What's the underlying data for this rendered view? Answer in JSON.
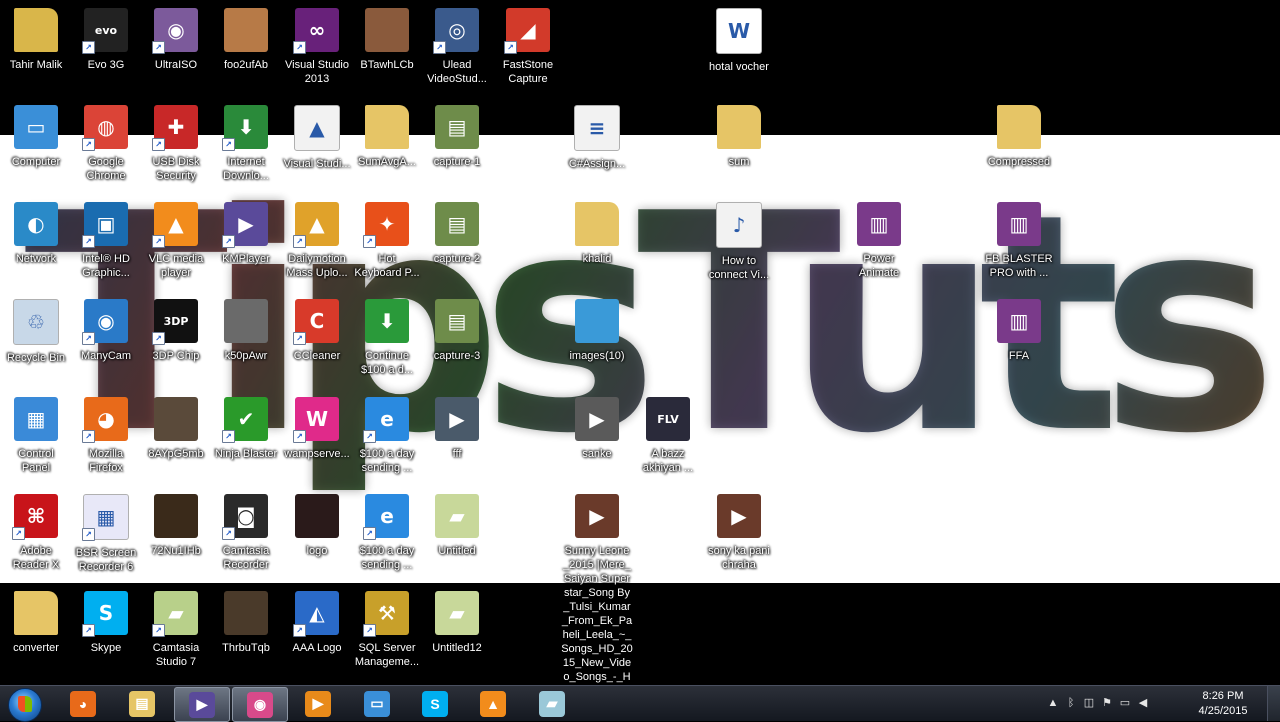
{
  "desktop": {
    "icons": [
      {
        "label": "Tahir Malik",
        "icon": "user-folder-icon",
        "color": "#d9b64a",
        "glyph": "",
        "shortcut": false
      },
      {
        "label": "Evo 3G",
        "icon": "evo-icon",
        "color": "#222222",
        "glyph": "evo",
        "shortcut": true
      },
      {
        "label": "UltraISO",
        "icon": "disc-icon",
        "color": "#7c5a9b",
        "glyph": "◉",
        "shortcut": true
      },
      {
        "label": "foo2ufAb",
        "icon": "photo-icon",
        "color": "#b77a47",
        "glyph": "",
        "shortcut": false
      },
      {
        "label": "Visual Studio\n2013",
        "icon": "visual-studio-icon",
        "color": "#68217a",
        "glyph": "∞",
        "shortcut": true
      },
      {
        "label": "BTawhLCb",
        "icon": "photo-icon",
        "color": "#8a5a3c",
        "glyph": "",
        "shortcut": false
      },
      {
        "label": "Ulead\nVideoStud...",
        "icon": "video-studio-icon",
        "color": "#3a5a8c",
        "glyph": "◎",
        "shortcut": true
      },
      {
        "label": "FastStone\nCapture",
        "icon": "faststone-icon",
        "color": "#d23a2a",
        "glyph": "◢",
        "shortcut": true
      },
      {
        "label": "hotal vocher",
        "icon": "word-document-icon",
        "color": "#ffffff",
        "glyph": "W",
        "shortcut": false
      },
      {
        "label": "Computer",
        "icon": "computer-icon",
        "color": "#3a8fd8",
        "glyph": "▭",
        "shortcut": false
      },
      {
        "label": "Google\nChrome",
        "icon": "chrome-icon",
        "color": "#db4437",
        "glyph": "◍",
        "shortcut": true
      },
      {
        "label": "USB Disk\nSecurity",
        "icon": "shield-icon",
        "color": "#c82828",
        "glyph": "✚",
        "shortcut": true
      },
      {
        "label": "Internet\nDownlo...",
        "icon": "download-manager-icon",
        "color": "#2a8a3a",
        "glyph": "⬇",
        "shortcut": true
      },
      {
        "label": "Visual Studi...",
        "icon": "vlc-file-icon",
        "color": "#f2f2f2",
        "glyph": "▲",
        "shortcut": false
      },
      {
        "label": "SumAvgA...",
        "icon": "folder-icon",
        "color": "#e6c566",
        "glyph": "",
        "shortcut": false
      },
      {
        "label": "capture-1",
        "icon": "video-file-icon",
        "color": "#6e8c4a",
        "glyph": "▤",
        "shortcut": false
      },
      {
        "label": "C#Assign...",
        "icon": "text-file-icon",
        "color": "#f2f2f2",
        "glyph": "≡",
        "shortcut": false
      },
      {
        "label": "sum",
        "icon": "folder-icon",
        "color": "#e6c566",
        "glyph": "",
        "shortcut": false
      },
      {
        "label": "Compressed",
        "icon": "folder-icon",
        "color": "#e6c566",
        "glyph": "",
        "shortcut": false
      },
      {
        "label": "Network",
        "icon": "network-icon",
        "color": "#2a8ac8",
        "glyph": "◐",
        "shortcut": false
      },
      {
        "label": "Intel® HD\nGraphic...",
        "icon": "intel-icon",
        "color": "#1a6cb0",
        "glyph": "▣",
        "shortcut": true
      },
      {
        "label": "VLC media\nplayer",
        "icon": "vlc-icon",
        "color": "#f28c1c",
        "glyph": "▲",
        "shortcut": true
      },
      {
        "label": "KMPlayer",
        "icon": "kmplayer-icon",
        "color": "#5a4a9a",
        "glyph": "▶",
        "shortcut": true
      },
      {
        "label": "Dailymotion\nMass Uplo...",
        "icon": "rocket-icon",
        "color": "#e0a22a",
        "glyph": "▲",
        "shortcut": true
      },
      {
        "label": "Hot\nKeyboard P...",
        "icon": "hot-keyboard-icon",
        "color": "#e8501a",
        "glyph": "✦",
        "shortcut": true
      },
      {
        "label": "capture-2",
        "icon": "video-file-icon",
        "color": "#6e8c4a",
        "glyph": "▤",
        "shortcut": false
      },
      {
        "label": "khalid",
        "icon": "folder-icon",
        "color": "#e6c566",
        "glyph": "",
        "shortcut": false
      },
      {
        "label": "How to\nconnect Vi...",
        "icon": "audio-file-icon",
        "color": "#f2f2f2",
        "glyph": "♪",
        "shortcut": false
      },
      {
        "label": "Power\nAnimate",
        "icon": "winrar-icon",
        "color": "#7a3a8a",
        "glyph": "▥",
        "shortcut": false
      },
      {
        "label": "FB BLASTER\nPRO with ...",
        "icon": "winrar-icon",
        "color": "#7a3a8a",
        "glyph": "▥",
        "shortcut": false
      },
      {
        "label": "Recycle Bin",
        "icon": "recycle-bin-icon",
        "color": "#c8d8e8",
        "glyph": "♲",
        "shortcut": false
      },
      {
        "label": "ManyCam",
        "icon": "manycam-icon",
        "color": "#2a7ac8",
        "glyph": "◉",
        "shortcut": true
      },
      {
        "label": "3DP Chip",
        "icon": "3dp-chip-icon",
        "color": "#111111",
        "glyph": "3DP",
        "shortcut": true
      },
      {
        "label": "k50pAwr",
        "icon": "photo-icon",
        "color": "#6a6a6a",
        "glyph": "",
        "shortcut": false
      },
      {
        "label": "CCleaner",
        "icon": "ccleaner-icon",
        "color": "#d83a2a",
        "glyph": "C",
        "shortcut": true
      },
      {
        "label": "Continue\n$100 a d...",
        "icon": "setup-icon",
        "color": "#2a9a3a",
        "glyph": "⬇",
        "shortcut": false
      },
      {
        "label": "capture-3",
        "icon": "video-file-icon",
        "color": "#6e8c4a",
        "glyph": "▤",
        "shortcut": false
      },
      {
        "label": "images(10)",
        "icon": "image-file-icon",
        "color": "#3a9ad8",
        "glyph": "",
        "shortcut": false
      },
      {
        "label": "FFA",
        "icon": "winrar-icon",
        "color": "#7a3a8a",
        "glyph": "▥",
        "shortcut": false
      },
      {
        "label": "Control\nPanel",
        "icon": "control-panel-icon",
        "color": "#3a8ad8",
        "glyph": "▦",
        "shortcut": false
      },
      {
        "label": "Mozilla\nFirefox",
        "icon": "firefox-icon",
        "color": "#e86a1a",
        "glyph": "◕",
        "shortcut": true
      },
      {
        "label": "8AYpG5mb",
        "icon": "photo-icon",
        "color": "#5a4a3a",
        "glyph": "",
        "shortcut": false
      },
      {
        "label": "Ninja Blaster",
        "icon": "checkmark-icon",
        "color": "#2a9a2a",
        "glyph": "✔",
        "shortcut": true
      },
      {
        "label": "wampserve...",
        "icon": "wampserver-icon",
        "color": "#e02a8a",
        "glyph": "W",
        "shortcut": true
      },
      {
        "label": "$100 a day\nsending ...",
        "icon": "internet-explorer-icon",
        "color": "#2a8ae0",
        "glyph": "e",
        "shortcut": true
      },
      {
        "label": "fff",
        "icon": "video-file-icon",
        "color": "#4a5a6a",
        "glyph": "▶",
        "shortcut": false
      },
      {
        "label": "sanke",
        "icon": "video-file-icon",
        "color": "#5a5a5a",
        "glyph": "▶",
        "shortcut": false
      },
      {
        "label": "A bazz\nakhiyan ...",
        "icon": "flv-file-icon",
        "color": "#2a2a3a",
        "glyph": "FLV",
        "shortcut": false
      },
      {
        "label": "Adobe\nReader X",
        "icon": "adobe-reader-icon",
        "color": "#c8141a",
        "glyph": "⌘",
        "shortcut": true
      },
      {
        "label": "BSR Screen\nRecorder 6",
        "icon": "bsr-recorder-icon",
        "color": "#e8e8f8",
        "glyph": "▦",
        "shortcut": true
      },
      {
        "label": "72Nu1IHb",
        "icon": "photo-icon",
        "color": "#3a2a1a",
        "glyph": "",
        "shortcut": false
      },
      {
        "label": "Camtasia\nRecorder",
        "icon": "camtasia-recorder-icon",
        "color": "#2a2a2a",
        "glyph": "◙",
        "shortcut": true
      },
      {
        "label": "logo",
        "icon": "image-file-icon",
        "color": "#2a1a1a",
        "glyph": "",
        "shortcut": false
      },
      {
        "label": "$100 a day\nsending ...",
        "icon": "internet-explorer-icon",
        "color": "#2a8ae0",
        "glyph": "e",
        "shortcut": true
      },
      {
        "label": "Untitled",
        "icon": "camtasia-file-icon",
        "color": "#c8d89a",
        "glyph": "▰",
        "shortcut": false
      },
      {
        "label": "Sunny Leone\n_2015 |Mere_\nSaiyan Super\nstar_Song By\n_Tulsi_Kumar\n_From_Ek_Pa\nheli_Leela_~_\nSongs_HD_20\n15_New_Vide\no_Songs_-_H",
        "icon": "video-file-icon",
        "color": "#6a3a2a",
        "glyph": "▶",
        "shortcut": false
      },
      {
        "label": "sony ka pani\nchraha",
        "icon": "video-file-icon",
        "color": "#6a3a2a",
        "glyph": "▶",
        "shortcut": false
      },
      {
        "label": "converter",
        "icon": "folder-icon",
        "color": "#e6c566",
        "glyph": "",
        "shortcut": false
      },
      {
        "label": "Skype",
        "icon": "skype-icon",
        "color": "#00aff0",
        "glyph": "S",
        "shortcut": true
      },
      {
        "label": "Camtasia\nStudio 7",
        "icon": "camtasia-studio-icon",
        "color": "#b8d08a",
        "glyph": "▰",
        "shortcut": true
      },
      {
        "label": "ThrbuTqb",
        "icon": "photo-icon",
        "color": "#4a3a2a",
        "glyph": "",
        "shortcut": false
      },
      {
        "label": "AAA Logo",
        "icon": "aaa-logo-icon",
        "color": "#2a6ac8",
        "glyph": "◭",
        "shortcut": true
      },
      {
        "label": "SQL Server\nManageme...",
        "icon": "sql-server-icon",
        "color": "#c8a02a",
        "glyph": "⚒",
        "shortcut": true
      },
      {
        "label": "Untitled12",
        "icon": "camtasia-file-icon",
        "color": "#c8d89a",
        "glyph": "▰",
        "shortcut": false
      }
    ]
  },
  "wallpaper": {
    "text": "TipsTuts"
  },
  "taskbar": {
    "start_icon": "windows-start-icon",
    "buttons": [
      {
        "name": "firefox",
        "icon": "firefox-icon",
        "color": "#e86a1a",
        "glyph": "◕",
        "active": false
      },
      {
        "name": "explorer",
        "icon": "folder-icon",
        "color": "#e6c566",
        "glyph": "▤",
        "active": false
      },
      {
        "name": "kmplayer",
        "icon": "kmplayer-icon",
        "color": "#5a4a9a",
        "glyph": "▶",
        "active": true
      },
      {
        "name": "ultraiso",
        "icon": "disc-icon",
        "color": "#d84a8a",
        "glyph": "◉",
        "active": true
      },
      {
        "name": "media-player",
        "icon": "media-player-icon",
        "color": "#e88a1a",
        "glyph": "▶",
        "active": false
      },
      {
        "name": "network-tool",
        "icon": "computer-icon",
        "color": "#3a8fd8",
        "glyph": "▭",
        "active": false
      },
      {
        "name": "skype",
        "icon": "skype-icon",
        "color": "#00aff0",
        "glyph": "S",
        "active": false
      },
      {
        "name": "vlc",
        "icon": "vlc-icon",
        "color": "#f28c1c",
        "glyph": "▲",
        "active": false
      },
      {
        "name": "camtasia",
        "icon": "camtasia-studio-icon",
        "color": "#9ac8d8",
        "glyph": "▰",
        "active": false
      }
    ],
    "tray": {
      "time": "8:26 PM",
      "date": "4/25/2015"
    }
  }
}
